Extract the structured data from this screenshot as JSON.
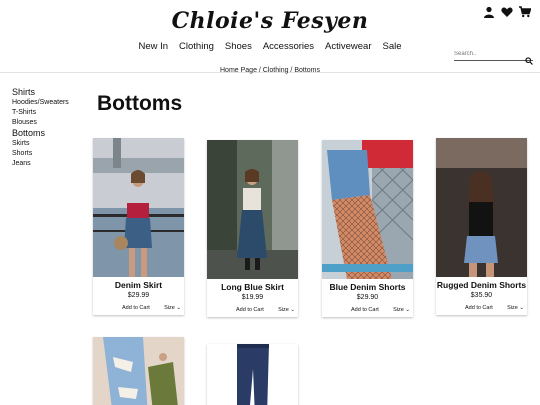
{
  "header": {
    "brand": "Chloie's Fesyen",
    "nav": [
      "New In",
      "Clothing",
      "Shoes",
      "Accessories",
      "Activewear",
      "Sale"
    ],
    "icons": [
      "user-icon",
      "heart-icon",
      "cart-icon"
    ],
    "search_placeholder": "Search.."
  },
  "breadcrumb": "Home Page / Clothing / Bottoms",
  "sidebar": {
    "shirts": "Shirts",
    "shirt_items": [
      "Hoodies/Sweaters",
      "T-Shirts",
      "Blouses"
    ],
    "bottoms": "Bottoms",
    "bottom_items": [
      "Skirts",
      "Shorts",
      "Jeans"
    ]
  },
  "page_title": "Bottoms",
  "products": [
    {
      "name": "Denim Skirt",
      "price": "$29.99",
      "cart": "Add to Cart",
      "size": "Size"
    },
    {
      "name": "Long Blue Skirt",
      "price": "$19.99",
      "cart": "Add to Cart",
      "size": "Size"
    },
    {
      "name": "Blue Denim Shorts",
      "price": "$29.90",
      "cart": "Add to Cart",
      "size": "Size"
    },
    {
      "name": "Rugged Denim Shorts",
      "price": "$35.90",
      "cart": "Add to Cart",
      "size": "Size"
    }
  ]
}
